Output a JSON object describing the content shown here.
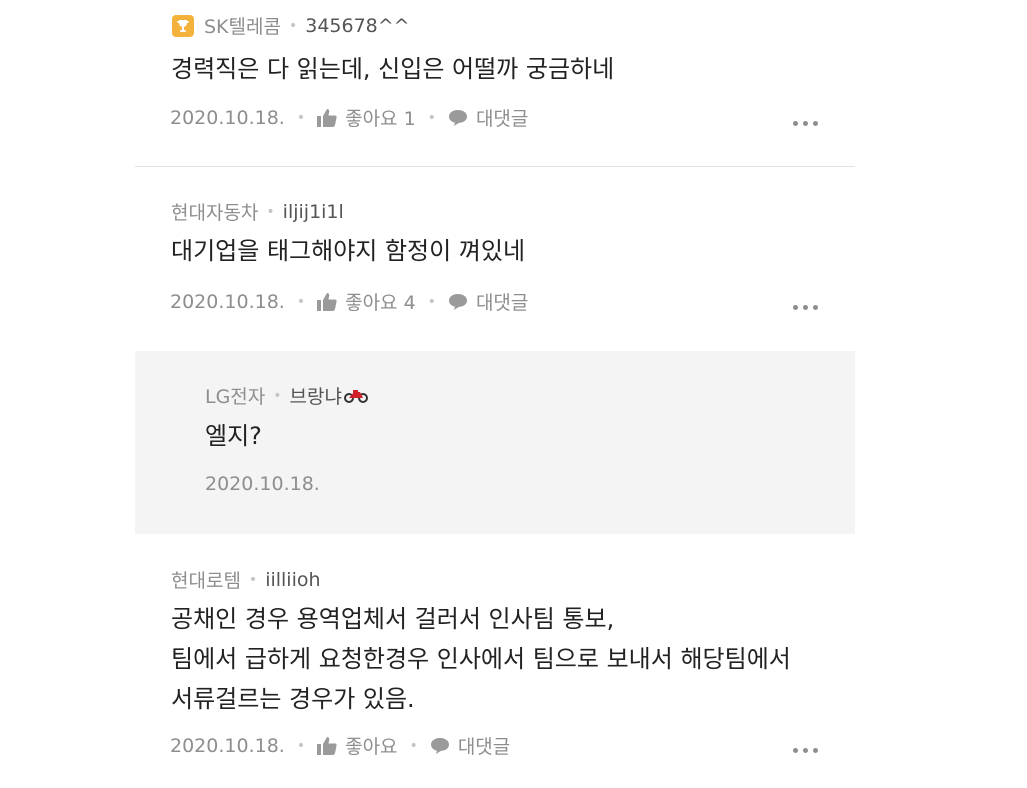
{
  "comments": [
    {
      "company": "SK텔레콤",
      "nickname": "345678^^",
      "badge_icon": "trophy-icon",
      "text": "경력직은 다 읽는데, 신입은 어떨까 궁금하네",
      "date": "2020.10.18.",
      "like_label": "좋아요 1",
      "reply_label": "대댓글"
    },
    {
      "company": "현대자동차",
      "nickname": "iljij1i1l",
      "text": "대기업을 태그해야지 함정이 껴있네",
      "date": "2020.10.18.",
      "like_label": "좋아요 4",
      "reply_label": "대댓글"
    },
    {
      "company": "현대로템",
      "nickname": "iilliioh",
      "text_lines": [
        "공채인 경우 용역업체서 걸러서 인사팀 통보,",
        "팀에서 급하게 요청한경우 인사에서 팀으로 보내서 해당팀에서",
        "서류걸르는 경우가 있음."
      ],
      "date": "2020.10.18.",
      "like_label": "좋아요",
      "reply_label": "대댓글"
    }
  ],
  "reply": {
    "company": "LG전자",
    "nickname": "브랑냐",
    "nickname_icon": "motorcycle-icon",
    "text": "엘지?",
    "date": "2020.10.18."
  },
  "colors": {
    "meta_gray": "#8e8e8e",
    "text_dark": "#222222",
    "reply_bg": "#f4f4f4",
    "badge_gold": "#f3b23c",
    "motorcycle_red": "#d0202a"
  }
}
